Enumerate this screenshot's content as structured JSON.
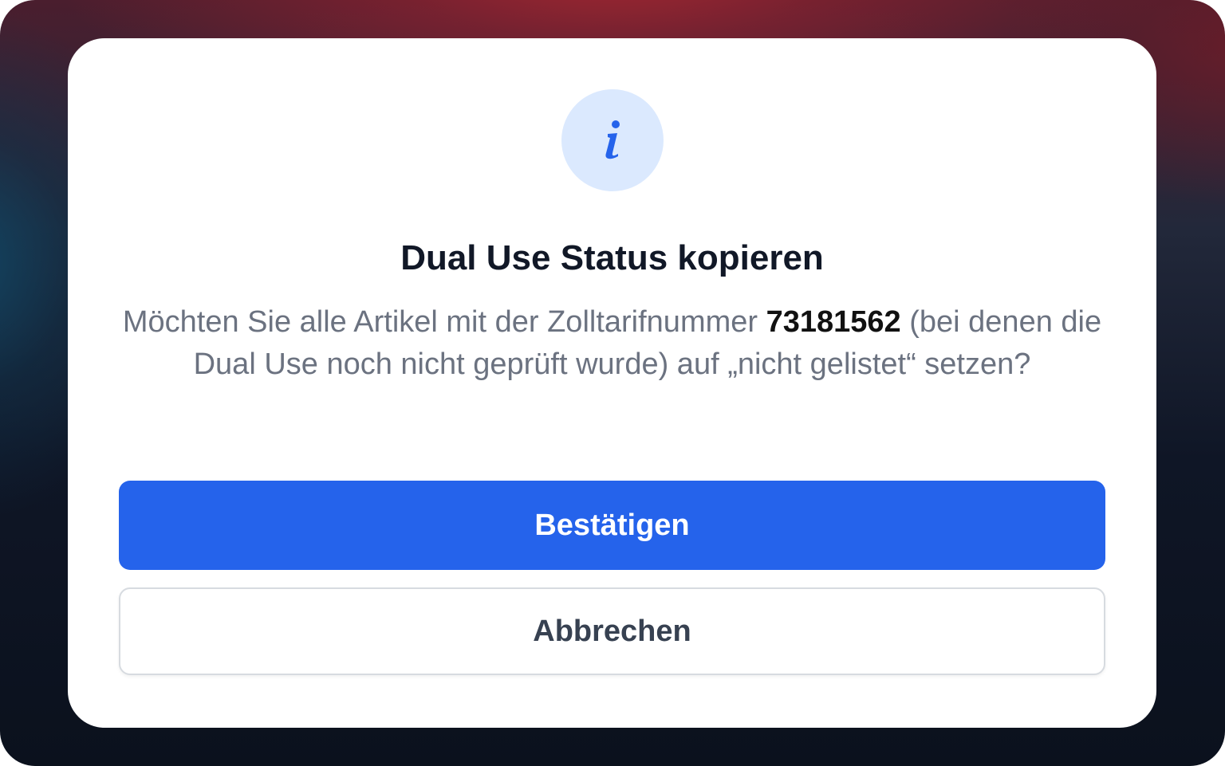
{
  "dialog": {
    "icon": "info-icon",
    "icon_glyph": "i",
    "title": "Dual Use Status kopieren",
    "message": {
      "before_code": "Möchten Sie alle Artikel mit der Zolltarifnummer ",
      "code": "73181562",
      "after_code": " (bei denen die Dual Use noch nicht geprüft wurde) auf „nicht gelistet“ setzen?"
    },
    "confirm_label": "Bestätigen",
    "cancel_label": "Abbrechen"
  },
  "colors": {
    "primary": "#2563eb",
    "icon_background": "#dbe9fe",
    "icon_foreground": "#2563eb",
    "title": "#111827",
    "message": "#6b7280"
  }
}
